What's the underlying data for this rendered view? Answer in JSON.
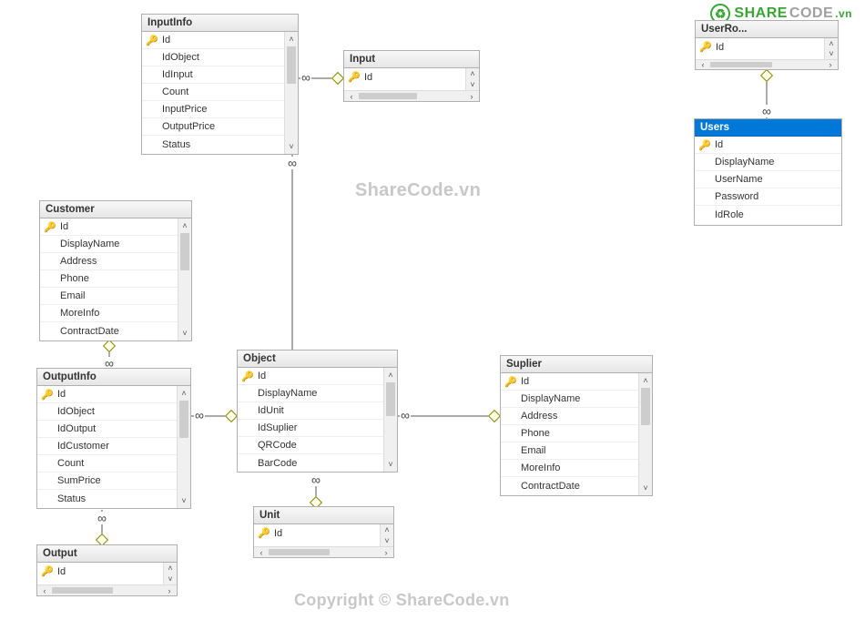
{
  "watermarks": {
    "center": "ShareCode.vn",
    "bottom": "Copyright © ShareCode.vn"
  },
  "logo": {
    "share": "SHARE",
    "code": "CODE",
    "ext": ".vn"
  },
  "tables": {
    "inputinfo": {
      "title": "InputInfo",
      "cols": [
        {
          "name": "Id",
          "pk": true
        },
        {
          "name": "IdObject",
          "pk": false
        },
        {
          "name": "IdInput",
          "pk": false
        },
        {
          "name": "Count",
          "pk": false
        },
        {
          "name": "InputPrice",
          "pk": false
        },
        {
          "name": "OutputPrice",
          "pk": false
        },
        {
          "name": "Status",
          "pk": false
        }
      ]
    },
    "input": {
      "title": "Input",
      "cols": [
        {
          "name": "Id",
          "pk": true
        }
      ]
    },
    "customer": {
      "title": "Customer",
      "cols": [
        {
          "name": "Id",
          "pk": true
        },
        {
          "name": "DisplayName",
          "pk": false
        },
        {
          "name": "Address",
          "pk": false
        },
        {
          "name": "Phone",
          "pk": false
        },
        {
          "name": "Email",
          "pk": false
        },
        {
          "name": "MoreInfo",
          "pk": false
        },
        {
          "name": "ContractDate",
          "pk": false
        }
      ]
    },
    "outputinfo": {
      "title": "OutputInfo",
      "cols": [
        {
          "name": "Id",
          "pk": true
        },
        {
          "name": "IdObject",
          "pk": false
        },
        {
          "name": "IdOutput",
          "pk": false
        },
        {
          "name": "IdCustomer",
          "pk": false
        },
        {
          "name": "Count",
          "pk": false
        },
        {
          "name": "SumPrice",
          "pk": false
        },
        {
          "name": "Status",
          "pk": false
        }
      ]
    },
    "output": {
      "title": "Output",
      "cols": [
        {
          "name": "Id",
          "pk": true
        }
      ]
    },
    "object": {
      "title": "Object",
      "cols": [
        {
          "name": "Id",
          "pk": true
        },
        {
          "name": "DisplayName",
          "pk": false
        },
        {
          "name": "IdUnit",
          "pk": false
        },
        {
          "name": "IdSuplier",
          "pk": false
        },
        {
          "name": "QRCode",
          "pk": false
        },
        {
          "name": "BarCode",
          "pk": false
        }
      ]
    },
    "suplier": {
      "title": "Suplier",
      "cols": [
        {
          "name": "Id",
          "pk": true
        },
        {
          "name": "DisplayName",
          "pk": false
        },
        {
          "name": "Address",
          "pk": false
        },
        {
          "name": "Phone",
          "pk": false
        },
        {
          "name": "Email",
          "pk": false
        },
        {
          "name": "MoreInfo",
          "pk": false
        },
        {
          "name": "ContractDate",
          "pk": false
        }
      ]
    },
    "unit": {
      "title": "Unit",
      "cols": [
        {
          "name": "Id",
          "pk": true
        }
      ]
    },
    "userrole": {
      "title": "UserRo...",
      "cols": [
        {
          "name": "Id",
          "pk": true
        }
      ]
    },
    "users": {
      "title": "Users",
      "cols": [
        {
          "name": "Id",
          "pk": true
        },
        {
          "name": "DisplayName",
          "pk": false
        },
        {
          "name": "UserName",
          "pk": false
        },
        {
          "name": "Password",
          "pk": false
        },
        {
          "name": "IdRole",
          "pk": false
        }
      ]
    }
  },
  "relations": [
    {
      "from": "InputInfo",
      "to": "Input"
    },
    {
      "from": "InputInfo",
      "to": "Object"
    },
    {
      "from": "OutputInfo",
      "to": "Customer"
    },
    {
      "from": "OutputInfo",
      "to": "Object"
    },
    {
      "from": "OutputInfo",
      "to": "Output"
    },
    {
      "from": "Object",
      "to": "Suplier"
    },
    {
      "from": "Object",
      "to": "Unit"
    },
    {
      "from": "Users",
      "to": "UserRole"
    }
  ]
}
